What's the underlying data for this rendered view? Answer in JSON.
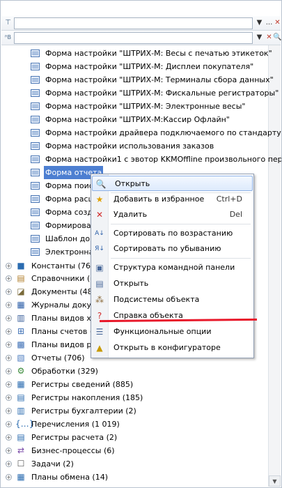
{
  "forms": [
    "Форма настройки \"ШТРИХ-М: Весы с печатью этикеток\"",
    "Форма настройки \"ШТРИХ-М: Дисплеи покупателя\"",
    "Форма настройки \"ШТРИХ-М: Терминалы сбора данных\"",
    "Форма настройки \"ШТРИХ-М: Фискальные регистраторы\"",
    "Форма настройки \"ШТРИХ-М: Электронные весы\"",
    "Форма настройки \"ШТРИХ-М:Кассир Офлайн\"",
    "Форма настройки драйвера подключаемого по стандарту \"...",
    "Форма настройки использования заказов",
    "Форма настройки1 с эвотор KKMOffline произвольного пер...",
    "Форма отчета",
    "Форма поис",
    "Форма расш",
    "Форма созд",
    "Формирова",
    "Шаблон дове",
    "Электронная"
  ],
  "categories": [
    {
      "label": "Константы (769)",
      "icon": "constants-icon"
    },
    {
      "label": "Справочники (66",
      "icon": "catalogs-icon"
    },
    {
      "label": "Документы (481",
      "icon": "documents-icon"
    },
    {
      "label": "Журналы докуме",
      "icon": "journals-icon"
    },
    {
      "label": "Планы видов хар",
      "icon": "characteristics-icon"
    },
    {
      "label": "Планы счетов (2",
      "icon": "chart-of-accounts-icon"
    },
    {
      "label": "Планы видов рас",
      "icon": "calculation-types-icon"
    },
    {
      "label": "Отчеты (706)",
      "icon": "reports-icon"
    },
    {
      "label": "Обработки (329)",
      "icon": "data-processors-icon"
    },
    {
      "label": "Регистры сведений (885)",
      "icon": "info-registers-icon"
    },
    {
      "label": "Регистры накопления (185)",
      "icon": "accumulation-registers-icon"
    },
    {
      "label": "Регистры бухгалтерии (2)",
      "icon": "accounting-registers-icon"
    },
    {
      "label": "Перечисления (1 019)",
      "icon": "enums-icon"
    },
    {
      "label": "Регистры расчета (2)",
      "icon": "calculation-registers-icon"
    },
    {
      "label": "Бизнес-процессы (6)",
      "icon": "business-processes-icon"
    },
    {
      "label": "Задачи (2)",
      "icon": "tasks-icon"
    },
    {
      "label": "Планы обмена (14)",
      "icon": "exchange-plans-icon"
    }
  ],
  "menu": {
    "open_top": "Открыть",
    "add_fav": "Добавить в избранное",
    "add_fav_sc": "Ctrl+D",
    "delete": "Удалить",
    "delete_sc": "Del",
    "sort_asc": "Сортировать по возрастанию",
    "sort_desc": "Сортировать по убыванию",
    "cmd_panel": "Структура командной панели",
    "open": "Открыть",
    "subsystems": "Подсистемы объекта",
    "help": "Справка объекта",
    "func_options": "Функциональные опции",
    "open_designer": "Открыть в конфигураторе"
  },
  "colors": {
    "selection": "#4d7fd1",
    "annotation": "#e8182a"
  }
}
